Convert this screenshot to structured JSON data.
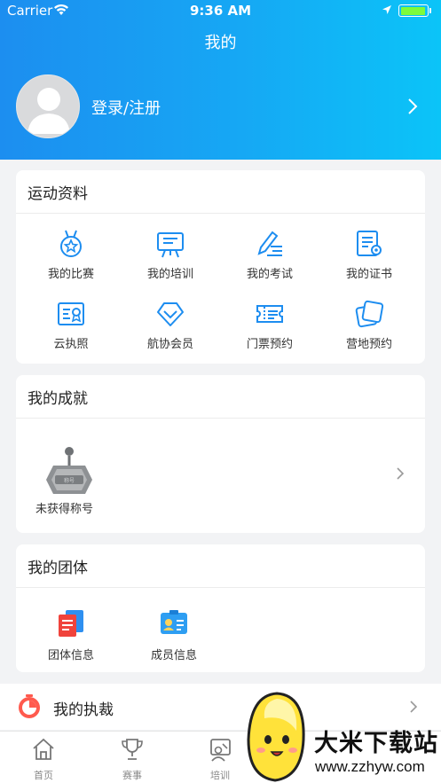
{
  "status_bar": {
    "carrier": "Carrier",
    "time": "9:36 AM"
  },
  "header": {
    "title": "我的",
    "login_label": "登录/注册"
  },
  "sports_data": {
    "title": "运动资料",
    "items": [
      {
        "label": "我的比赛",
        "icon": "medal-icon"
      },
      {
        "label": "我的培训",
        "icon": "training-board-icon"
      },
      {
        "label": "我的考试",
        "icon": "exam-pen-icon"
      },
      {
        "label": "我的证书",
        "icon": "certificate-icon"
      },
      {
        "label": "云执照",
        "icon": "license-icon"
      },
      {
        "label": "航协会员",
        "icon": "diamond-member-icon"
      },
      {
        "label": "门票预约",
        "icon": "ticket-icon"
      },
      {
        "label": "营地预约",
        "icon": "campsite-icon"
      }
    ]
  },
  "achievements": {
    "title": "我的成就",
    "badge_label": "未获得称号",
    "badge_icon": "title-badge-icon"
  },
  "team": {
    "title": "我的团体",
    "items": [
      {
        "label": "团体信息",
        "icon": "team-document-icon"
      },
      {
        "label": "成员信息",
        "icon": "member-card-icon"
      }
    ]
  },
  "referee": {
    "label": "我的执裁",
    "icon": "whistle-icon"
  },
  "tabbar": {
    "tabs": [
      {
        "label": "首页",
        "icon": "home-icon"
      },
      {
        "label": "赛事",
        "icon": "trophy-icon"
      },
      {
        "label": "培训",
        "icon": "training-icon"
      }
    ]
  },
  "watermark": {
    "title": "大米下载站",
    "url": "www.zzhyw.com"
  },
  "colors": {
    "header_start": "#1c8ef0",
    "header_end": "#0bc4f8",
    "icon_blue": "#1d8df0",
    "background": "#f2f3f5"
  }
}
